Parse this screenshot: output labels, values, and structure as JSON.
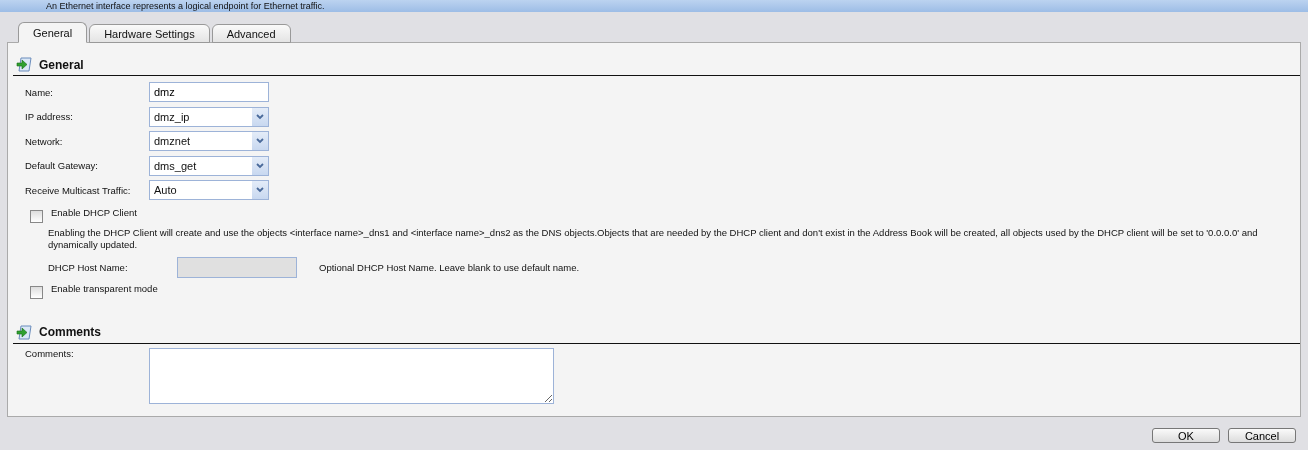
{
  "banner": {
    "text": "An Ethernet interface represents a logical endpoint for Ethernet traffic."
  },
  "tabs": [
    {
      "label": "General",
      "selected": true
    },
    {
      "label": "Hardware Settings",
      "selected": false
    },
    {
      "label": "Advanced",
      "selected": false
    }
  ],
  "general": {
    "heading": "General",
    "fields": [
      {
        "kind": "text",
        "label": "Name:",
        "value": "dmz"
      },
      {
        "kind": "select",
        "label": "IP address:",
        "value": "dmz_ip"
      },
      {
        "kind": "select",
        "label": "Network:",
        "value": "dmznet"
      },
      {
        "kind": "select",
        "label": "Default Gateway:",
        "value": "dms_get"
      },
      {
        "kind": "select",
        "label": "Receive Multicast Traffic:",
        "value": "Auto"
      }
    ],
    "dhcp": {
      "label": "Enable DHCP Client",
      "checked": false,
      "description": "Enabling the DHCP Client will create and use the objects <interface name>_dns1 and <interface name>_dns2 as the DNS objects.Objects that are needed by the DHCP client and don't exist in the Address Book will be created, all objects used by the DHCP client will be set to '0.0.0.0' and dynamically updated.",
      "host_label": "DHCP Host Name:",
      "host_disabled": true,
      "host_hint": "Optional DHCP Host Name. Leave blank to use default name."
    },
    "transparent": {
      "label": "Enable transparent mode",
      "checked": false
    }
  },
  "comments": {
    "heading": "Comments",
    "label": "Comments:"
  },
  "buttons": [
    "OK",
    "Cancel"
  ]
}
